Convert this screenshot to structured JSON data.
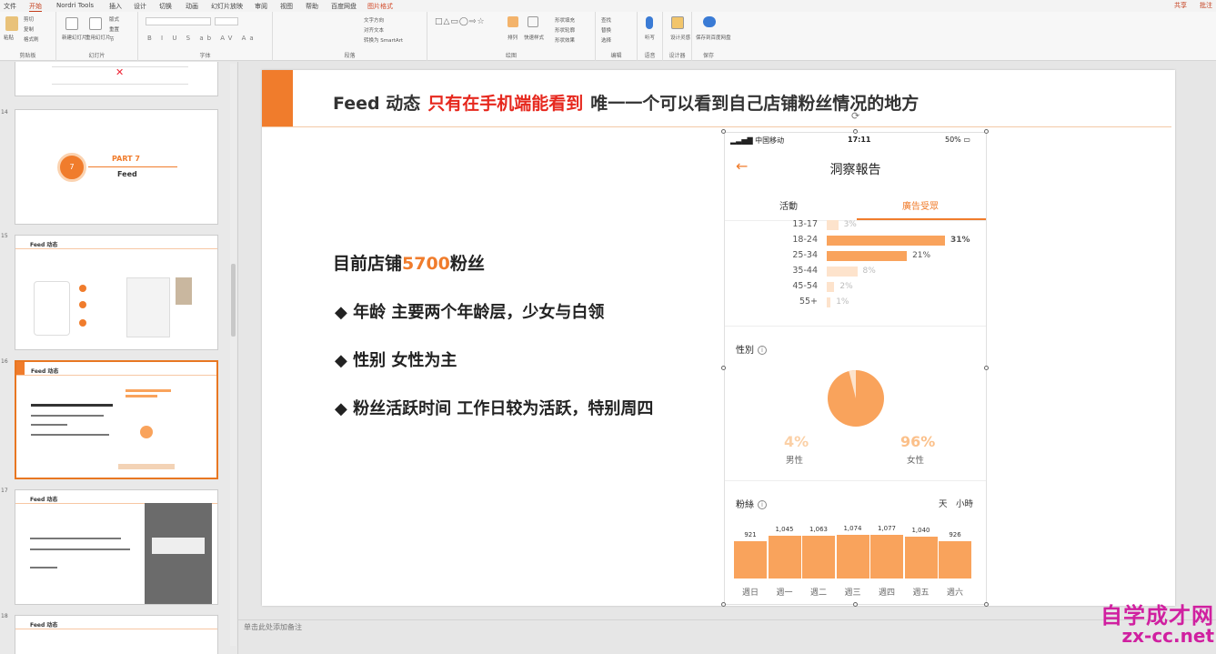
{
  "menu": {
    "items": [
      "文件",
      "开始",
      "Nordri Tools",
      "插入",
      "设计",
      "切换",
      "动画",
      "幻灯片放映",
      "审阅",
      "视图",
      "帮助",
      "百度网盘",
      "图片格式"
    ],
    "active": "开始",
    "share": "共享",
    "comment": "批注"
  },
  "ribbon": {
    "groups": [
      "剪贴板",
      "幻灯片",
      "字体",
      "段落",
      "绘图",
      "编辑",
      "语音",
      "设计器",
      "保存"
    ],
    "clipboard": {
      "paste": "粘贴",
      "cut": "剪切",
      "copy": "复制",
      "format": "格式刷"
    },
    "slides": {
      "new": "新建幻灯片",
      "reuse": "重用幻灯片",
      "layout": "版式",
      "reset": "重置",
      "section": "节"
    },
    "paragraph": {
      "text_dir": "文字方向",
      "align": "对齐文本",
      "smartart": "转换为 SmartArt"
    },
    "drawing": {
      "arrange": "排列",
      "quick": "快速样式",
      "fill": "形状填充",
      "outline": "形状轮廓",
      "effect": "形状效果"
    },
    "editing": {
      "find": "查找",
      "replace": "替换",
      "select": "选择"
    },
    "voice": {
      "dictate": "听写"
    },
    "designer": {
      "ideas": "设计灵感"
    },
    "save": {
      "baidu": "保存到百度网盘"
    }
  },
  "thumbs": [
    {
      "num": "",
      "text": ""
    },
    {
      "num": "14",
      "part": "PART 7",
      "sub": "Feed",
      "circle": "7"
    },
    {
      "num": "15",
      "title": "Feed 动态"
    },
    {
      "num": "16",
      "title": "Feed 动态"
    },
    {
      "num": "17",
      "title": "Feed 动态"
    },
    {
      "num": "18",
      "title": "Feed 动态"
    }
  ],
  "slide": {
    "title_a": "Feed 动态",
    "title_b": "只有在手机端能看到",
    "title_c": "唯一一个可以看到自己店铺粉丝情况的地方",
    "fans_a": "目前店铺",
    "fans_num": "5700",
    "fans_b": "粉丝",
    "bullets": [
      "◆ 年龄 主要两个年龄层，少女与白领",
      "◆ 性别 女性为主",
      "◆ 粉丝活跃时间  工作日较为活跃，特别周四"
    ]
  },
  "phone": {
    "carrier": "中国移动",
    "time": "17:11",
    "battery": "50%",
    "title": "洞察報告",
    "tab1": "活動",
    "tab2": "廣告受眾",
    "ages": [
      {
        "label": "13-17",
        "pct": 3,
        "txt": "3%"
      },
      {
        "label": "18-24",
        "pct": 31,
        "txt": "31%"
      },
      {
        "label": "25-34",
        "pct": 21,
        "txt": "21%"
      },
      {
        "label": "35-44",
        "pct": 8,
        "txt": "8%"
      },
      {
        "label": "45-54",
        "pct": 2,
        "txt": "2%"
      },
      {
        "label": "55+",
        "pct": 1,
        "txt": "1%"
      }
    ],
    "gender_title": "性別",
    "info": "i",
    "male_pct": "4%",
    "male_lbl": "男性",
    "female_pct": "96%",
    "female_lbl": "女性",
    "fans_title": "粉絲",
    "day": "天",
    "hour": "小時",
    "days": [
      {
        "label": "週日",
        "value": 921,
        "txt": "921"
      },
      {
        "label": "週一",
        "value": 1045,
        "txt": "1,045"
      },
      {
        "label": "週二",
        "value": 1063,
        "txt": "1,063"
      },
      {
        "label": "週三",
        "value": 1074,
        "txt": "1,074"
      },
      {
        "label": "週四",
        "value": 1077,
        "txt": "1,077"
      },
      {
        "label": "週五",
        "value": 1040,
        "txt": "1,040"
      },
      {
        "label": "週六",
        "value": 926,
        "txt": "926"
      }
    ]
  },
  "notes": "单击此处添加备注",
  "watermark": {
    "line1": "自学成才网",
    "line2": "zx-cc.net"
  },
  "colors": {
    "accent": "#f07c2c",
    "bar": "#f9a35c",
    "title_red": "#e6281e"
  }
}
